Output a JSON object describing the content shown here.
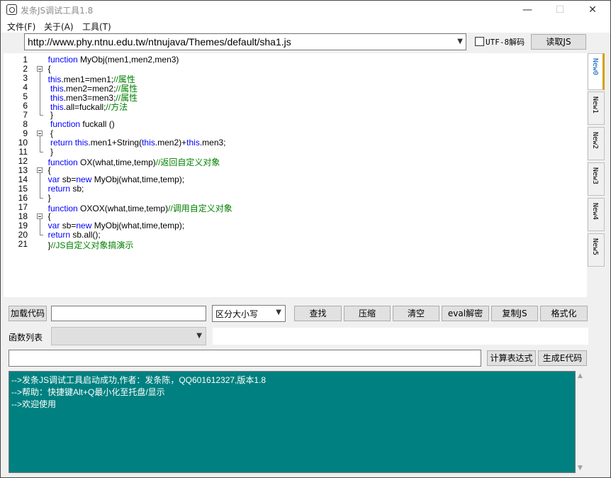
{
  "window": {
    "title": "发条JS调试工具1.8",
    "minimize": "—",
    "maximize": "☐",
    "close": "✕"
  },
  "menu": [
    "文件(F)",
    "关于(A)",
    "工具(T)"
  ],
  "url_bar": {
    "value": "http://www.phy.ntnu.edu.tw/ntnujava/Themes/default/sha1.js",
    "utf8_label": "UTF-8解码",
    "utf8_checked": false,
    "read_button": "读取JS"
  },
  "editor": {
    "lines": [
      {
        "n": "1",
        "segs": [
          {
            "t": "function ",
            "c": "kw"
          },
          {
            "t": "MyObj(men1,men2,men3)",
            "c": ""
          }
        ],
        "indent": "  "
      },
      {
        "n": "2",
        "segs": [
          {
            "t": "{",
            "c": ""
          }
        ],
        "indent": "  "
      },
      {
        "n": "3",
        "segs": [
          {
            "t": "this",
            "c": "kw"
          },
          {
            "t": ".men1=men1;",
            "c": ""
          },
          {
            "t": "//属性",
            "c": "cm"
          }
        ],
        "indent": "  "
      },
      {
        "n": "4",
        "segs": [
          {
            "t": "this",
            "c": "kw"
          },
          {
            "t": ".men2=men2;",
            "c": ""
          },
          {
            "t": "//属性",
            "c": "cm"
          }
        ],
        "indent": "   "
      },
      {
        "n": "5",
        "segs": [
          {
            "t": "this",
            "c": "kw"
          },
          {
            "t": ".men3=men3;",
            "c": ""
          },
          {
            "t": "//属性",
            "c": "cm"
          }
        ],
        "indent": "   "
      },
      {
        "n": "6",
        "segs": [
          {
            "t": "this",
            "c": "kw"
          },
          {
            "t": ".all=fuckall;",
            "c": ""
          },
          {
            "t": "//方法",
            "c": "cm"
          }
        ],
        "indent": "   "
      },
      {
        "n": "7",
        "segs": [
          {
            "t": "}",
            "c": ""
          }
        ],
        "indent": "   "
      },
      {
        "n": "8",
        "segs": [
          {
            "t": "function ",
            "c": "kw"
          },
          {
            "t": "fuckall ()",
            "c": ""
          }
        ],
        "indent": "   "
      },
      {
        "n": "9",
        "segs": [
          {
            "t": "{",
            "c": ""
          }
        ],
        "indent": "   "
      },
      {
        "n": "10",
        "segs": [
          {
            "t": "return ",
            "c": "kw"
          },
          {
            "t": "this",
            "c": "kw"
          },
          {
            "t": ".men1+String(",
            "c": ""
          },
          {
            "t": "this",
            "c": "kw"
          },
          {
            "t": ".men2)+",
            "c": ""
          },
          {
            "t": "this",
            "c": "kw"
          },
          {
            "t": ".men3;",
            "c": ""
          }
        ],
        "indent": "   "
      },
      {
        "n": "11",
        "segs": [
          {
            "t": "}",
            "c": ""
          }
        ],
        "indent": "   "
      },
      {
        "n": "12",
        "segs": [
          {
            "t": "function ",
            "c": "kw"
          },
          {
            "t": "OX(what,time,temp)",
            "c": ""
          },
          {
            "t": "//返回自定义对象",
            "c": "cm"
          }
        ],
        "indent": "  "
      },
      {
        "n": "13",
        "segs": [
          {
            "t": "{",
            "c": ""
          }
        ],
        "indent": "  "
      },
      {
        "n": "14",
        "segs": [
          {
            "t": "var ",
            "c": "kw"
          },
          {
            "t": "sb=",
            "c": ""
          },
          {
            "t": "new ",
            "c": "kw"
          },
          {
            "t": "MyObj(what,time,temp);",
            "c": ""
          }
        ],
        "indent": "  "
      },
      {
        "n": "15",
        "segs": [
          {
            "t": "return ",
            "c": "kw"
          },
          {
            "t": "sb;",
            "c": ""
          }
        ],
        "indent": "  "
      },
      {
        "n": "16",
        "segs": [
          {
            "t": "}",
            "c": ""
          }
        ],
        "indent": "  "
      },
      {
        "n": "17",
        "segs": [
          {
            "t": "function ",
            "c": "kw"
          },
          {
            "t": "OXOX(what,time,temp)",
            "c": ""
          },
          {
            "t": "//调用自定义对象",
            "c": "cm"
          }
        ],
        "indent": "  "
      },
      {
        "n": "18",
        "segs": [
          {
            "t": "{",
            "c": ""
          }
        ],
        "indent": "  "
      },
      {
        "n": "19",
        "segs": [
          {
            "t": "var ",
            "c": "kw"
          },
          {
            "t": "sb=",
            "c": ""
          },
          {
            "t": "new ",
            "c": "kw"
          },
          {
            "t": "MyObj(what,time,temp);",
            "c": ""
          }
        ],
        "indent": "  "
      },
      {
        "n": "20",
        "segs": [
          {
            "t": "return ",
            "c": "kw"
          },
          {
            "t": "sb.all();",
            "c": ""
          }
        ],
        "indent": "  "
      },
      {
        "n": "21",
        "segs": [
          {
            "t": "}",
            "c": ""
          },
          {
            "t": "//JS自定义对象搞演示",
            "c": "cm"
          }
        ],
        "indent": "  "
      }
    ]
  },
  "tabs": [
    "New0",
    "New1",
    "New2",
    "New3",
    "New4",
    "New5"
  ],
  "controls": {
    "load_code": "加载代码",
    "case_select": "区分大小写",
    "find": "查找",
    "compress": "压缩",
    "clear": "清空",
    "eval_decode": "eval解密",
    "copy_js": "复制JS",
    "format": "格式化",
    "function_list": "函数列表",
    "calc_expr": "计算表达式",
    "gen_e_code": "生成E代码"
  },
  "console": {
    "lines": [
      "-->发条JS调试工具启动成功,作者：发条陈，QQ601612327,版本1.8",
      "-->帮助：快捷键Alt+Q最小化至托盘/显示",
      "-->欢迎使用"
    ]
  },
  "colors": {
    "console_bg": "#008080",
    "keyword": "#0000ff",
    "comment": "#008000"
  }
}
